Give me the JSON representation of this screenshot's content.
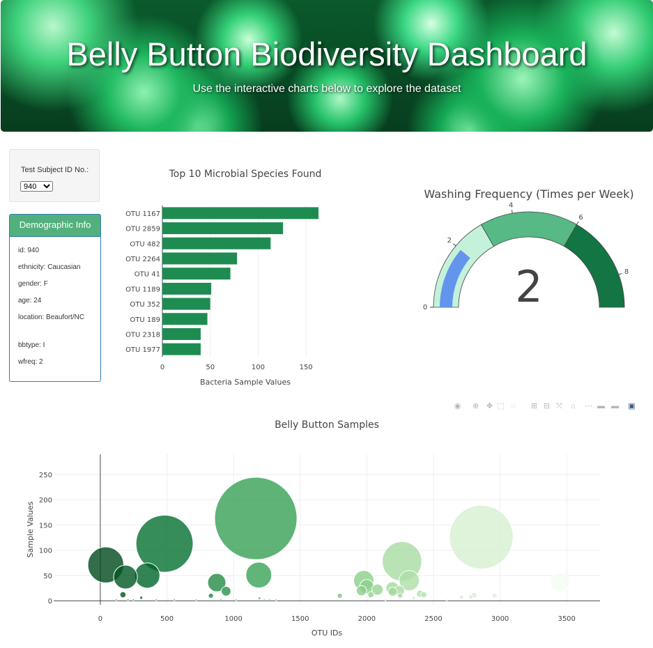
{
  "header": {
    "title": "Belly Button Biodiversity Dashboard",
    "subtitle": "Use the interactive charts below to explore the dataset"
  },
  "selector": {
    "label": "Test Subject ID No.:",
    "selected": "940"
  },
  "demographics": {
    "title": "Demographic Info",
    "items": [
      "id: 940",
      "ethnicity: Caucasian",
      "gender: F",
      "age: 24",
      "location: Beaufort/NC",
      "bbtype: I",
      "wfreq: 2"
    ]
  },
  "modebar_icons": [
    "camera-icon",
    "zoom-icon",
    "pan-icon",
    "box-select-icon",
    "lasso-icon",
    "zoom-in-icon",
    "zoom-out-icon",
    "autoscale-icon",
    "home-icon",
    "spike-lines-icon",
    "hover-closest-icon",
    "hover-compare-icon",
    "plotly-logo-icon"
  ],
  "chart_data": [
    {
      "type": "bar",
      "orientation": "horizontal",
      "title": "Top 10 Microbial Species Found",
      "xlabel": "Bacteria Sample Values",
      "categories": [
        "OTU 1167",
        "OTU 2859",
        "OTU 482",
        "OTU 2264",
        "OTU 41",
        "OTU 1189",
        "OTU 352",
        "OTU 189",
        "OTU 2318",
        "OTU 1977"
      ],
      "values": [
        163,
        126,
        113,
        78,
        71,
        51,
        50,
        47,
        40,
        40
      ],
      "xticks": [
        0,
        50,
        100,
        150
      ],
      "xlim": [
        0,
        171
      ],
      "color": "#1e8c51"
    },
    {
      "type": "gauge",
      "title": "Washing Frequency (Times per Week)",
      "value": 2,
      "range": [
        0,
        9
      ],
      "ticks": [
        0,
        2,
        4,
        6,
        8
      ],
      "steps": [
        {
          "range": [
            0,
            3
          ],
          "color": "#c3f1da"
        },
        {
          "range": [
            3,
            6
          ],
          "color": "#57b985"
        },
        {
          "range": [
            6,
            9
          ],
          "color": "#137543"
        }
      ],
      "bar_color": "#6495ed"
    },
    {
      "type": "scatter",
      "mode": "bubble",
      "title": "Belly Button Samples",
      "xlabel": "OTU IDs",
      "ylabel": "Sample Values",
      "xlim": [
        -350,
        3750
      ],
      "ylim": [
        -8,
        290
      ],
      "xticks": [
        0,
        500,
        1000,
        1500,
        2000,
        2500,
        3000,
        3500
      ],
      "yticks": [
        0,
        50,
        100,
        150,
        200,
        250
      ],
      "colorscale": "Greens",
      "points": [
        {
          "x": 1167,
          "y": 163
        },
        {
          "x": 2859,
          "y": 126
        },
        {
          "x": 482,
          "y": 113
        },
        {
          "x": 2264,
          "y": 78
        },
        {
          "x": 41,
          "y": 71
        },
        {
          "x": 1189,
          "y": 51
        },
        {
          "x": 352,
          "y": 50
        },
        {
          "x": 189,
          "y": 47
        },
        {
          "x": 2318,
          "y": 40
        },
        {
          "x": 1977,
          "y": 40
        },
        {
          "x": 3450,
          "y": 37
        },
        {
          "x": 874,
          "y": 36
        },
        {
          "x": 2000,
          "y": 28
        },
        {
          "x": 2191,
          "y": 25
        },
        {
          "x": 2080,
          "y": 22
        },
        {
          "x": 2245,
          "y": 20
        },
        {
          "x": 1960,
          "y": 20
        },
        {
          "x": 944,
          "y": 19
        },
        {
          "x": 2194,
          "y": 18
        },
        {
          "x": 2400,
          "y": 14
        },
        {
          "x": 2428,
          "y": 12
        },
        {
          "x": 2030,
          "y": 12
        },
        {
          "x": 2805,
          "y": 11
        },
        {
          "x": 830,
          "y": 10
        },
        {
          "x": 2250,
          "y": 10
        },
        {
          "x": 1797,
          "y": 10
        },
        {
          "x": 2958,
          "y": 10
        },
        {
          "x": 170,
          "y": 12
        },
        {
          "x": 2780,
          "y": 8
        },
        {
          "x": 2710,
          "y": 7
        },
        {
          "x": 307,
          "y": 6
        },
        {
          "x": 1195,
          "y": 5
        },
        {
          "x": 2350,
          "y": 5
        },
        {
          "x": 1270,
          "y": 3
        },
        {
          "x": 905,
          "y": 3
        },
        {
          "x": 1230,
          "y": 3
        },
        {
          "x": 120,
          "y": 2
        },
        {
          "x": 208,
          "y": 2
        },
        {
          "x": 250,
          "y": 2
        },
        {
          "x": 420,
          "y": 2
        },
        {
          "x": 556,
          "y": 2
        },
        {
          "x": 720,
          "y": 2
        },
        {
          "x": 1020,
          "y": 2
        },
        {
          "x": 1320,
          "y": 2
        },
        {
          "x": 2140,
          "y": 2
        },
        {
          "x": 2600,
          "y": 2
        }
      ]
    }
  ]
}
